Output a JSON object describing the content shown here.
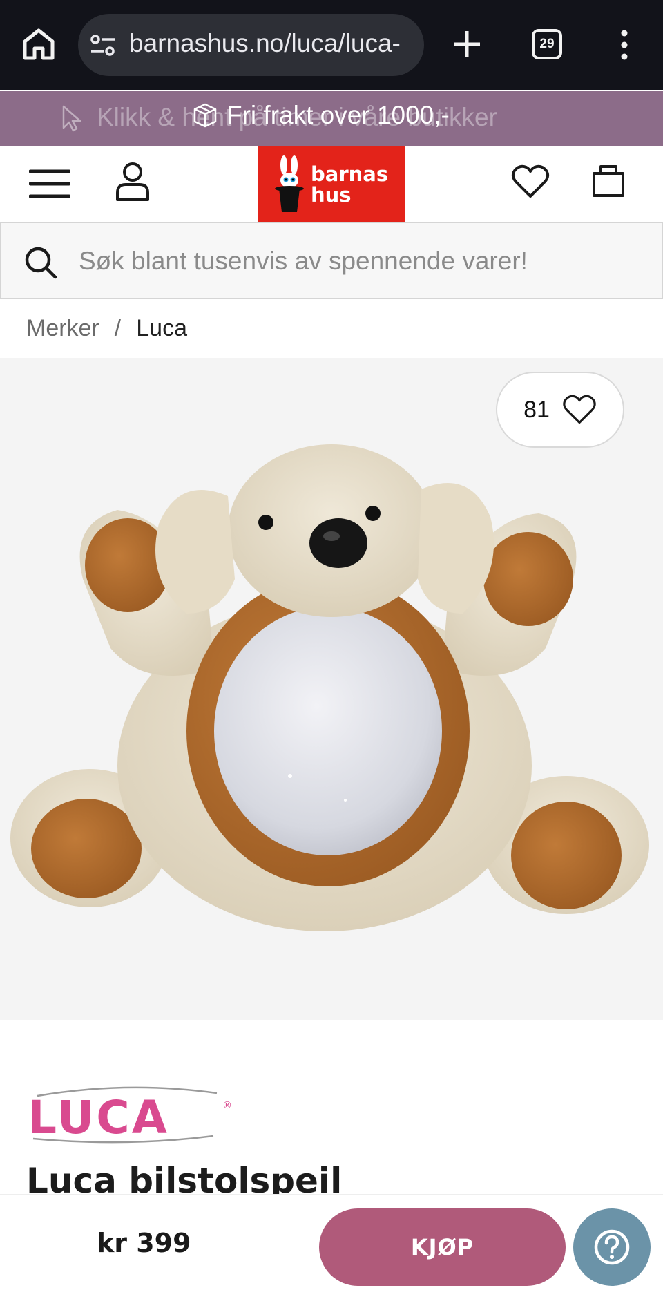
{
  "browser": {
    "url": "barnashus.no/luca/luca-",
    "tab_count": "29",
    "icons": [
      "home-icon",
      "site-settings-icon",
      "new-tab-icon",
      "tabs-icon",
      "more-vert-icon"
    ]
  },
  "promo": {
    "ghost_text": "Klikk & hent på timer i våre butikker",
    "text": "Fri frakt over 1000,-",
    "color": "#8c6c89"
  },
  "header": {
    "brand_line1": "barnas",
    "brand_line2": "hus",
    "logo_color": "#e3231a"
  },
  "search": {
    "placeholder": "Søk blant tusenvis av spennende varer!"
  },
  "breadcrumb": {
    "items": [
      "Merker",
      "Luca"
    ],
    "separator": "/"
  },
  "product": {
    "favorite_count": "81",
    "brand": "LUCA",
    "title": "Luca bilstolspeil",
    "image_description_icon": "plush-dog-mirror-image"
  },
  "buybar": {
    "price": "kr 399",
    "buy_label": "KJØP",
    "buy_color": "#b05a7a",
    "help_color": "#6b93a8"
  }
}
